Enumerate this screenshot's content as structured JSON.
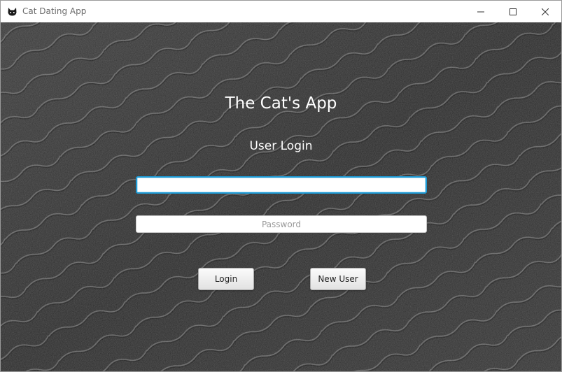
{
  "window": {
    "title": "Cat Dating App",
    "icon": "cat-icon",
    "controls": [
      "minimize-icon",
      "maximize-icon",
      "close-icon"
    ]
  },
  "main": {
    "app_title": "The Cat's App",
    "subtitle": "User Login",
    "username": {
      "value": "",
      "placeholder": ""
    },
    "password": {
      "value": "",
      "placeholder": "Password"
    },
    "login_label": "Login",
    "new_user_label": "New User"
  },
  "colors": {
    "background": "#2b2b2b",
    "focus_ring": "#1e9bd6",
    "text_light": "#ffffff"
  }
}
